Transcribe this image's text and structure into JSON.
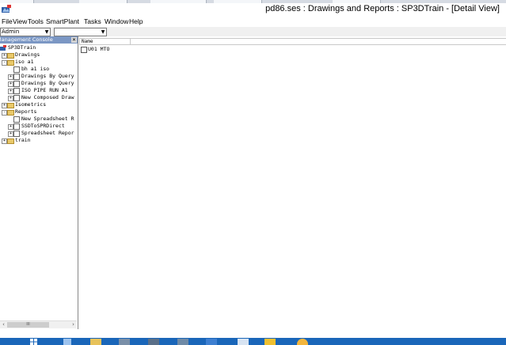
{
  "window": {
    "title": "pd86.ses : Drawings and Reports : SP3DTrain - [Detail View]"
  },
  "menu": [
    "File",
    "View",
    "Tools",
    "SmartPlant",
    "Tasks",
    "Window",
    "Help"
  ],
  "toolbar": {
    "combo1_value": "Admin",
    "combo2_value": ""
  },
  "console": {
    "header": "Management Console",
    "tree": [
      {
        "label": "SP3DTrain",
        "icon": "root-icon",
        "expander": "",
        "level": 0
      },
      {
        "label": "Drawings",
        "icon": "folder-icon",
        "expander": "+",
        "level": 1
      },
      {
        "label": "iso a1",
        "icon": "folder-icon",
        "expander": "-",
        "level": 1
      },
      {
        "label": "bh a1 iso",
        "icon": "document-icon",
        "expander": "",
        "level": 2
      },
      {
        "label": "Drawings By Query",
        "icon": "document-icon",
        "expander": "+",
        "level": 2
      },
      {
        "label": "Drawings By Query",
        "icon": "document-icon",
        "expander": "+",
        "level": 2
      },
      {
        "label": "ISO PIPE RUN A1",
        "icon": "document-icon",
        "expander": "+",
        "level": 2
      },
      {
        "label": "New Composed Draw",
        "icon": "document-icon",
        "expander": "+",
        "level": 2
      },
      {
        "label": "Isometrics",
        "icon": "folder-icon",
        "expander": "+",
        "level": 1
      },
      {
        "label": "Reports",
        "icon": "folder-icon",
        "expander": "-",
        "level": 1
      },
      {
        "label": "New Spreadsheet R",
        "icon": "document-icon",
        "expander": "",
        "level": 2
      },
      {
        "label": "SSDToSPRDirect",
        "icon": "document-icon",
        "expander": "+",
        "level": 2
      },
      {
        "label": "Spreadsheet Repor",
        "icon": "document-icon",
        "expander": "+",
        "level": 2
      },
      {
        "label": "train",
        "icon": "folder-icon",
        "expander": "+",
        "level": 1
      }
    ],
    "scroll_thumb": "III"
  },
  "detail": {
    "column_header": "Name",
    "rows": [
      {
        "name": "U01 MTO"
      }
    ]
  },
  "taskbar": {
    "items": [
      "start-icon",
      "taskview-icon",
      "explorer-icon",
      "app-icon",
      "app-icon",
      "app-icon",
      "app-icon",
      "app-icon",
      "app-icon",
      "app-icon"
    ]
  },
  "colors": {
    "panel_header": "#7b97c4",
    "taskbar": "#1a66b9",
    "folder": "#e9c96a"
  }
}
